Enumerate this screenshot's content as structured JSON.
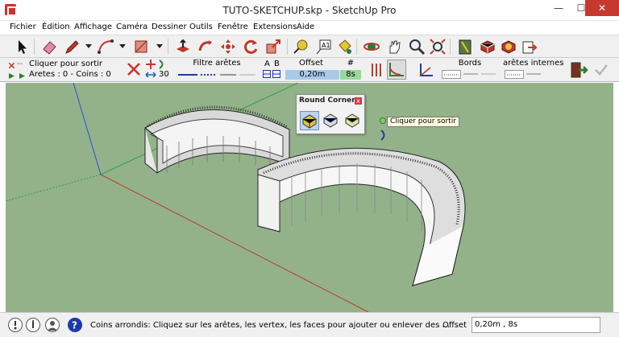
{
  "window": {
    "title": "TUTO-SKETCHUP.skp - SketchUp Pro",
    "minimize_glyph": "—",
    "maximize_glyph": "☐",
    "close_glyph": "✕"
  },
  "menu": {
    "items": [
      "Fichier",
      "Édition",
      "Affichage",
      "Caméra",
      "Dessiner",
      "Outils",
      "Fenêtre",
      "Extensions",
      "Aide"
    ]
  },
  "toolbar": {
    "icons": [
      "select-arrow-icon",
      "eraser-icon",
      "pencil-line-icon",
      "arc-icon",
      "rectangle-icon",
      "push-pull-icon",
      "follow-me-icon",
      "move-icon",
      "rotate-icon",
      "scale-icon",
      "tape-measure-icon",
      "text-label-icon",
      "paint-bucket-icon",
      "orbit-icon",
      "pan-hand-icon",
      "zoom-icon",
      "zoom-extents-icon",
      "book-icon",
      "component-red-icon",
      "component-yellow-icon",
      "export-icon"
    ]
  },
  "roundcorner_bar": {
    "exit_label": "Cliquer pour sortir",
    "counts_label": "Aretes : 0 - Coins : 0",
    "segments_value": "30",
    "edge_filter_label": "Filtre arêtes",
    "ab_a": "A",
    "ab_b": "B",
    "offset_label": "Offset",
    "hash_label": "#",
    "offset_value": "0,20m",
    "segments_count": "8s",
    "borders_label": "Bords",
    "inner_edges_label": "arêtes internes"
  },
  "palette": {
    "title": "Round Corner",
    "close_glyph": "x"
  },
  "tooltip": {
    "text": "Cliquer pour sortir"
  },
  "statusbar": {
    "message": "Coins arrondis: Cliquez sur les arêtes, les vertex, les faces pour ajouter ou enlever des ...",
    "value_label": "Offset",
    "value": "0,20m , 8s"
  },
  "colors": {
    "viewport_bg": "#93b28a",
    "offset_box": "#a9c9e8",
    "count_box": "#9ad89a",
    "axis_red": "#c0392b",
    "axis_green": "#2ea043",
    "axis_blue": "#2a4fd1"
  }
}
